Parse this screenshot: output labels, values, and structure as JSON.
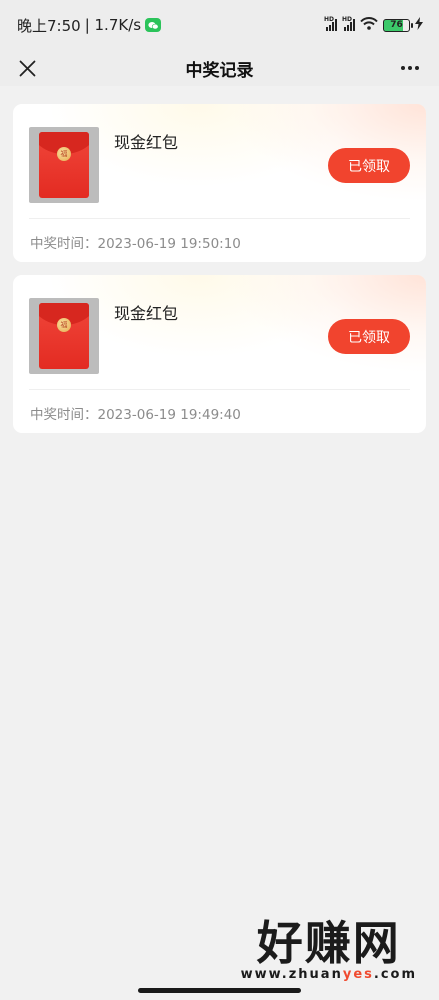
{
  "status_bar": {
    "time": "晚上7:50",
    "net_speed": "| 1.7K/s",
    "battery": "76",
    "signal_label": "HD"
  },
  "nav": {
    "title": "中奖记录",
    "close_icon": "close-icon",
    "more_icon": "more-icon"
  },
  "records": [
    {
      "prize": "现金红包",
      "status": "已领取",
      "time_label": "中奖时间：",
      "time": "2023-06-19 19:50:10"
    },
    {
      "prize": "现金红包",
      "status": "已领取",
      "time_label": "中奖时间：",
      "time": "2023-06-19 19:49:40"
    }
  ],
  "watermark": {
    "big": "好赚网",
    "small_a": "www.zhuan",
    "small_b": "yes",
    "small_c": ".com"
  },
  "colors": {
    "accent": "#f1442e",
    "background": "#f1f1f1"
  }
}
